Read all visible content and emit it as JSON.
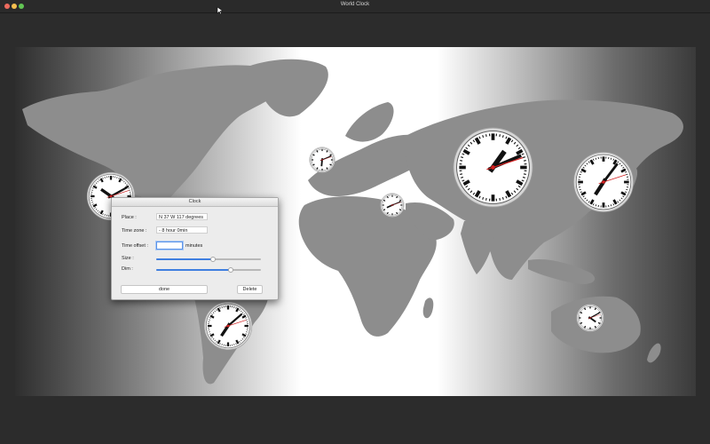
{
  "window": {
    "title": "World Clock"
  },
  "clocks": [
    {
      "id": "san-francisco",
      "hour": 10,
      "minute": 10,
      "second": 12
    },
    {
      "id": "london",
      "hour": 6,
      "minute": 11,
      "second": 12
    },
    {
      "id": "athens",
      "hour": 8,
      "minute": 11,
      "second": 12
    },
    {
      "id": "shanghai",
      "hour": 1,
      "minute": 11,
      "second": 12
    },
    {
      "id": "tokyo",
      "hour": 7,
      "minute": 6,
      "second": 12
    },
    {
      "id": "sao-paulo",
      "hour": 7,
      "minute": 8,
      "second": 12
    },
    {
      "id": "sydney",
      "hour": 4,
      "minute": 10,
      "second": 12
    }
  ],
  "dialog": {
    "title": "Clock",
    "place_label": "Place :",
    "place_value": "N 37  W 117  degrees",
    "timezone_label": "Time zone :",
    "timezone_value": "- 8 hour   0min",
    "offset_label": "Time offset :",
    "offset_value": "",
    "offset_unit": "minutes",
    "size_label": "Size :",
    "size_value": 0.54,
    "dim_label": "Dim :",
    "dim_value": 0.71,
    "done_label": "done",
    "delete_label": "Delete",
    "accent_color": "#3f7fe0"
  }
}
